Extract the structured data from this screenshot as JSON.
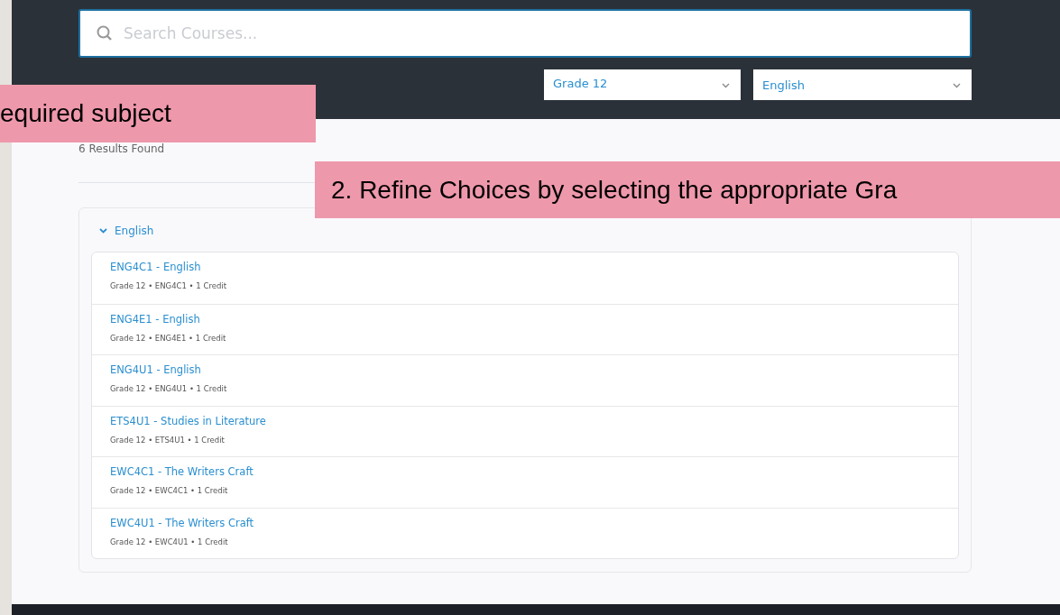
{
  "search": {
    "placeholder": "Search Courses..."
  },
  "filters": [
    {
      "value": "Grade 12"
    },
    {
      "value": "English"
    }
  ],
  "results_count": "6 Results Found",
  "group": {
    "title": "English",
    "expanded": true,
    "courses": [
      {
        "title": "ENG4C1 - English",
        "details": "Grade 12 • ENG4C1 • 1 Credit"
      },
      {
        "title": "ENG4E1 - English",
        "details": "Grade 12 • ENG4E1 • 1 Credit"
      },
      {
        "title": "ENG4U1 - English",
        "details": "Grade 12 • ENG4U1 • 1 Credit"
      },
      {
        "title": "ETS4U1 - Studies in Literature",
        "details": "Grade 12 • ETS4U1 • 1 Credit"
      },
      {
        "title": "EWC4C1 - The Writers Craft",
        "details": "Grade 12 • EWC4C1 • 1 Credit"
      },
      {
        "title": "EWC4U1 - The Writers Craft",
        "details": "Grade 12 • EWC4U1 • 1 Credit"
      }
    ]
  },
  "callouts": [
    {
      "text": "equired subject"
    },
    {
      "text": "2. Refine Choices by selecting the appropriate Gra"
    }
  ]
}
